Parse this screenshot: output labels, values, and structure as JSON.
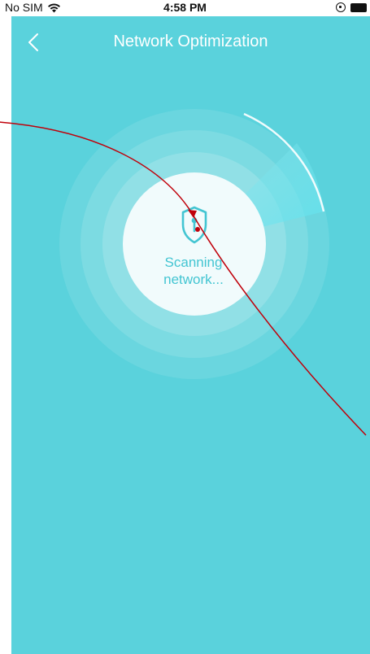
{
  "statusbar": {
    "carrier": "No SIM",
    "time": "4:58 PM",
    "wifi_icon": "wifi-icon",
    "orientation_lock_icon": "orientation-lock-icon",
    "battery_icon": "battery-icon"
  },
  "header": {
    "title": "Network Optimization",
    "back_icon": "chevron-left-icon"
  },
  "scan": {
    "status_line1": "Scanning",
    "status_line2": "network...",
    "icon": "shield-icon"
  },
  "colors": {
    "background": "#5ad2dc",
    "accent": "#43c5d2",
    "circle_fill": "#f1fbfc",
    "overlay_curve": "#c0000a"
  }
}
